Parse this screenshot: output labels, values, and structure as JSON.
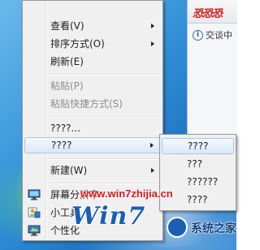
{
  "side_window": {
    "logo_text": "恐恐恐",
    "info_text": "交谈中"
  },
  "context_menu": {
    "items": [
      {
        "label": "查看(V)"
      },
      {
        "label": "排序方式(O)"
      },
      {
        "label": "刷新(E)"
      },
      {
        "label": "粘贴(P)"
      },
      {
        "label": "粘贴快捷方式(S)"
      },
      {
        "label": "????..."
      },
      {
        "label": "????"
      },
      {
        "label": "新建(W)"
      },
      {
        "label": "屏幕分辨率"
      },
      {
        "label": "小工具"
      },
      {
        "label": "个性化"
      }
    ]
  },
  "submenu": {
    "items": [
      {
        "label": "????"
      },
      {
        "label": "???"
      },
      {
        "label": "??????"
      },
      {
        "label": "????"
      }
    ]
  },
  "watermark": {
    "url": "www.win7zhijia.cn",
    "logo": "Win7",
    "badge_text": "系统之家"
  },
  "colors": {
    "menu_background": "#f0f0f0",
    "highlight_border": "#a9c6ea",
    "watermark_red": "#e01414",
    "watermark_blue": "#1a5fb4"
  }
}
